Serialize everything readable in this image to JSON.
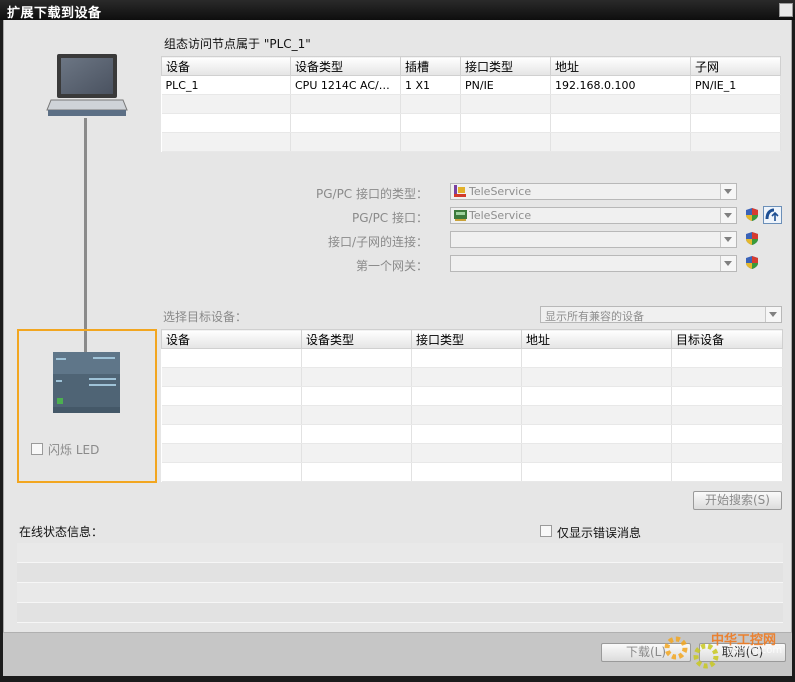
{
  "window": {
    "title": "扩展下载到设备"
  },
  "configured": {
    "heading_prefix": "组态访问节点属于 ",
    "heading_device": "\"PLC_1\"",
    "columns": [
      "设备",
      "设备类型",
      "插槽",
      "接口类型",
      "地址",
      "子网"
    ],
    "rows": [
      [
        "PLC_1",
        "CPU 1214C AC/D...",
        "1 X1",
        "PN/IE",
        "192.168.0.100",
        "PN/IE_1"
      ]
    ]
  },
  "interface": {
    "pgpc_type_label": "PG/PC 接口的类型：",
    "pgpc_type_value": "TeleService",
    "pgpc_label": "PG/PC 接口：",
    "pgpc_value": "TeleService",
    "subnet_conn_label": "接口/子网的连接：",
    "subnet_conn_value": "",
    "gateway_label": "第一个网关：",
    "gateway_value": ""
  },
  "target": {
    "select_label": "选择目标设备：",
    "filter_value": "显示所有兼容的设备",
    "columns": [
      "设备",
      "设备类型",
      "接口类型",
      "地址",
      "目标设备"
    ],
    "flash_led_label": "闪烁 LED",
    "start_search_label": "开始搜索(S)"
  },
  "status": {
    "heading": "在线状态信息：",
    "only_errors_label": "仅显示错误消息"
  },
  "footer": {
    "download_label": "下载(L)",
    "cancel_label": "取消(C)"
  },
  "watermark": {
    "text": "中华工控网",
    "url": "gkong.com"
  },
  "colors": {
    "highlight_border": "#f2a620",
    "title_bar": "#111111",
    "dialog_bg": "#e6e6e6"
  }
}
